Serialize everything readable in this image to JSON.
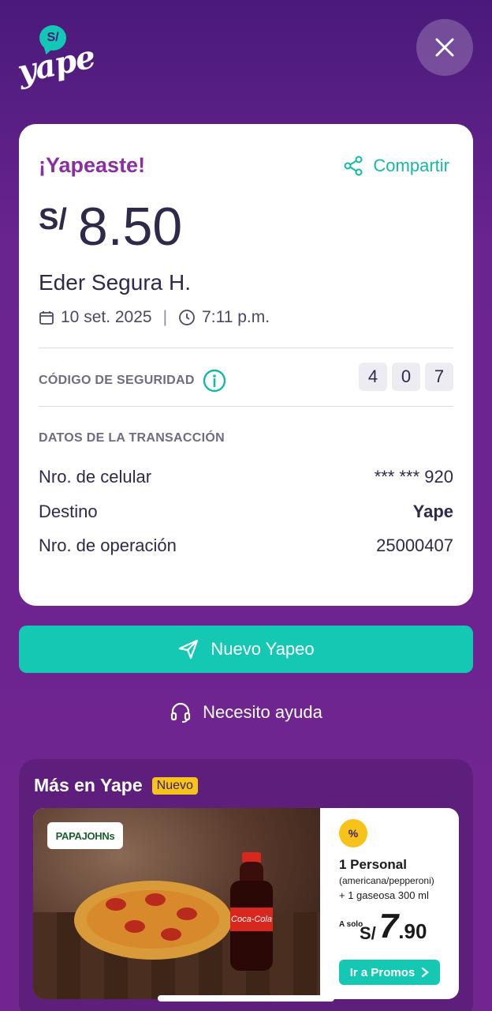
{
  "app": {
    "logo_badge": "S/",
    "logo_word": "yape"
  },
  "receipt": {
    "title": "¡Yapeaste!",
    "share_label": "Compartir",
    "currency": "S/",
    "amount": "8.50",
    "payee": "Eder Segura H.",
    "date": "10 set. 2025",
    "time": "7:11 p.m.",
    "security_label": "CÓDIGO DE SEGURIDAD",
    "security_code": [
      "4",
      "0",
      "7"
    ],
    "tx_heading": "DATOS DE LA TRANSACCIÓN",
    "rows": [
      {
        "label": "Nro. de celular",
        "value": "*** *** 920"
      },
      {
        "label": "Destino",
        "value": "Yape"
      },
      {
        "label": "Nro. de operación",
        "value": "25000407"
      }
    ]
  },
  "actions": {
    "new_payment": "Nuevo Yapeo",
    "help": "Necesito ayuda"
  },
  "more": {
    "title": "Más en Yape",
    "badge": "Nuevo",
    "promo": {
      "brand": "PAPAJOHNs",
      "bottle_label": "Coca-Cola",
      "discount_symbol": "%",
      "line1": "1 Personal",
      "line2": "(americana/pepperoni)",
      "line3": "+ 1 gaseosa 300 ml",
      "price_prefix": "A solo",
      "price_currency": "S/",
      "price_int": "7",
      "price_dec": ".90",
      "cta": "Ir a Promos"
    }
  },
  "colors": {
    "accent": "#15c8b4",
    "brand_purple": "#72258f",
    "title_purple": "#8a2ea0",
    "badge_yellow": "#f7c21a"
  },
  "icons": [
    "close-icon",
    "share-icon",
    "calendar-icon",
    "clock-icon",
    "info-icon",
    "send-icon",
    "headset-icon",
    "chevron-right-icon"
  ]
}
